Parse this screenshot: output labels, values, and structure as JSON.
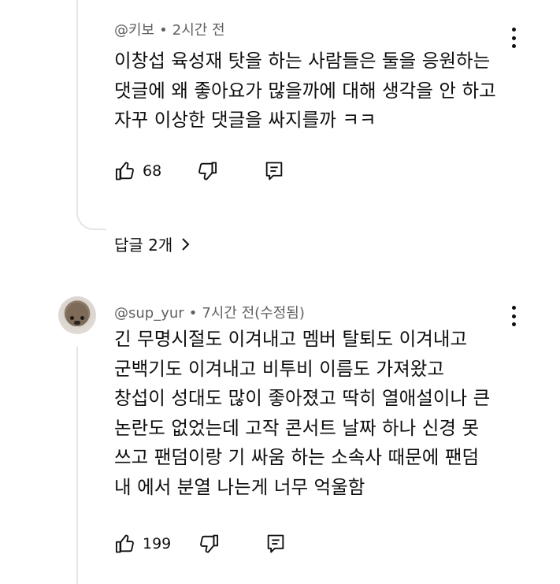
{
  "comments": [
    {
      "author": "@키보",
      "time": "2시간 전",
      "lines": [
        "이창섭 육성재 탓을 하는 사람들은 둘을 응원하는",
        "댓글에 왜 좋아요가 많을까에 대해 생각을 안 하고",
        "자꾸 이상한 댓글을 싸지를까 ㅋㅋ"
      ],
      "likes": "68",
      "replies_label": "답글 2개"
    },
    {
      "author": "@sup_yur",
      "time": "7시간 전(수정됨)",
      "lines": [
        "긴 무명시절도 이겨내고 멤버 탈퇴도 이겨내고",
        "군백기도 이겨내고 비투비 이름도 가져왔고",
        "창섭이 성대도 많이 좋아졌고 딱히 열애설이나 큰",
        "논란도 없었는데 고작 콘서트 날짜 하나 신경 못",
        "쓰고 팬덤이랑 기 싸움 하는 소속사 때문에 팬덤",
        "내 에서 분열 나는게 너무 억울함"
      ],
      "likes": "199"
    }
  ],
  "icons": [
    "thumbs-up-icon",
    "thumbs-down-icon",
    "reply-icon",
    "more-vert-icon",
    "chevron-right-icon"
  ],
  "colors": {
    "text": "#0f0f0f",
    "meta": "#606060",
    "thread": "#e5e5e5"
  }
}
